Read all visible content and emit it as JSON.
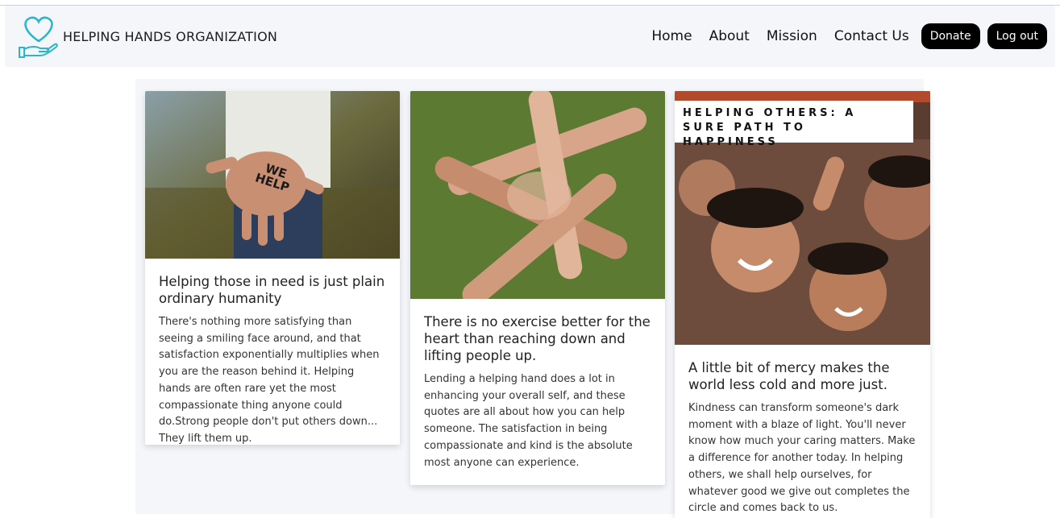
{
  "header": {
    "brand_name": "HELPING HANDS ORGANIZATION",
    "nav": [
      "Home",
      "About",
      "Mission",
      "Contact Us"
    ],
    "donate_label": "Donate",
    "logout_label": "Log out"
  },
  "colors": {
    "accent_teal": "#2bb5c8",
    "nav_bg": "#f4f6f9",
    "pill_bg": "#000000"
  },
  "cards": [
    {
      "image_text": "WE HELP",
      "title": "Helping those in need is just plain ordinary humanity",
      "text": "There's nothing more satisfying than seeing a smiling face around, and that satisfaction exponentially multiplies when you are the reason behind it. Helping hands are often rare yet the most compassionate thing anyone could do.Strong people don't put others down... They lift them up."
    },
    {
      "title": "There is no exercise better for the heart than reaching down and lifting people up.",
      "text": "Lending a helping hand does a lot in enhancing your overall self, and these quotes are all about how you can help someone. The satisfaction in being compassionate and kind is the absolute most anyone can experience."
    },
    {
      "image_text": "HELPING OTHERS: A SURE PATH TO HAPPINESS",
      "title": "A little bit of mercy makes the world less cold and more just.",
      "text": "Kindness can transform someone's dark moment with a blaze of light. You'll never know how much your caring matters. Make a difference for another today. In helping others, we shall help ourselves, for whatever good we give out completes the circle and comes back to us."
    }
  ]
}
